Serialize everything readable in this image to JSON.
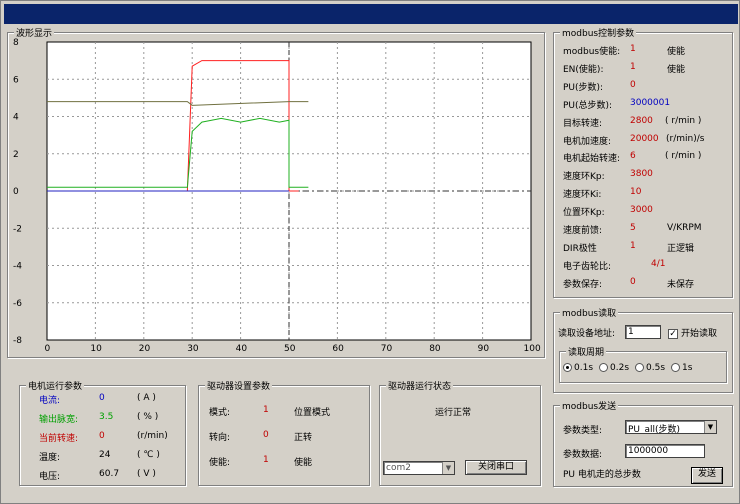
{
  "waveform": {
    "title": "波形显示",
    "y_ticks": [
      "8",
      "6",
      "4",
      "2",
      "0",
      "-2",
      "-4",
      "-6",
      "-8"
    ],
    "x_ticks": [
      "0",
      "10",
      "20",
      "30",
      "40",
      "50",
      "60",
      "70",
      "80",
      "90",
      "100"
    ],
    "colors": {
      "red": "#ff2020",
      "green": "#20b020",
      "olive": "#707040",
      "blue": "#2020c0"
    }
  },
  "chart_data": {
    "type": "line",
    "title": "",
    "xlabel": "",
    "ylabel": "",
    "xlim": [
      0,
      100
    ],
    "ylim": [
      -8,
      8
    ],
    "grid": true,
    "series": [
      {
        "color": "#ff2020",
        "x": [
          0,
          29,
          30,
          32,
          50,
          50,
          52
        ],
        "y": [
          0,
          0,
          6.7,
          7,
          7,
          0,
          0
        ]
      },
      {
        "color": "#20b020",
        "x": [
          0,
          29,
          30,
          32,
          36,
          40,
          44,
          48,
          50,
          50,
          54
        ],
        "y": [
          0.2,
          0.2,
          3.2,
          3.7,
          3.9,
          3.7,
          3.9,
          3.7,
          3.8,
          0.2,
          0.2
        ]
      },
      {
        "color": "#707040",
        "x": [
          0,
          29,
          30,
          50,
          54
        ],
        "y": [
          4.8,
          4.8,
          4.6,
          4.8,
          4.8
        ]
      },
      {
        "color": "#2020c0",
        "x": [
          0,
          50
        ],
        "y": [
          0,
          0
        ]
      }
    ]
  },
  "motor_params": {
    "title": "电机运行参数",
    "rows": [
      {
        "label": "电流:",
        "value": "0",
        "unit": "( A )",
        "color": "#0000c0"
      },
      {
        "label": "输出脉宽:",
        "value": "3.5",
        "unit": "( % )",
        "color": "#00a000"
      },
      {
        "label": "当前转速:",
        "value": "0",
        "unit": "(r/min)",
        "color": "#c00000"
      },
      {
        "label": "温度:",
        "value": "24",
        "unit": "( ℃ )",
        "color": "#000000"
      },
      {
        "label": "电压:",
        "value": "60.7",
        "unit": "( V )",
        "color": "#000000"
      }
    ]
  },
  "driver_settings": {
    "title": "驱动器设置参数",
    "rows": [
      {
        "label": "模式:",
        "value": "1",
        "desc": "位置模式"
      },
      {
        "label": "转向:",
        "value": "0",
        "desc": "正转"
      },
      {
        "label": "使能:",
        "value": "1",
        "desc": "使能"
      }
    ]
  },
  "driver_status": {
    "title": "驱动器运行状态",
    "status": "运行正常",
    "port": "com2",
    "close_port_label": "关闭串口"
  },
  "modbus_control": {
    "title": "modbus控制参数",
    "rows": [
      {
        "label": "modbus使能:",
        "value": "1",
        "desc": "使能"
      },
      {
        "label": "EN(使能):",
        "value": "1",
        "desc": "使能"
      },
      {
        "label": "PU(步数):",
        "value": "0",
        "desc": ""
      },
      {
        "label": "PU(总步数):",
        "value": "3000001",
        "desc": "",
        "blue": true
      },
      {
        "label": "目标转速:",
        "value": "2800",
        "desc": "( r/min )"
      },
      {
        "label": "电机加速度:",
        "value": "20000",
        "desc": "(r/min)/s"
      },
      {
        "label": "电机起始转速:",
        "value": "6",
        "desc": "( r/min )"
      },
      {
        "label": "速度环Kp:",
        "value": "3800",
        "desc": ""
      },
      {
        "label": "速度环Ki:",
        "value": "10",
        "desc": ""
      },
      {
        "label": "位置环Kp:",
        "value": "3000",
        "desc": ""
      },
      {
        "label": "速度前馈:",
        "value": "5",
        "desc": "V/KRPM"
      },
      {
        "label": "DIR极性",
        "value": "1",
        "desc": "正逻辑"
      },
      {
        "label": "电子齿轮比:",
        "value": "4/1",
        "desc": ""
      },
      {
        "label": "参数保存:",
        "value": "0",
        "desc": "未保存"
      }
    ]
  },
  "modbus_read": {
    "title": "modbus读取",
    "addr_label": "读取设备地址:",
    "addr_value": "1",
    "start_read_label": "开始读取",
    "period_title": "读取周期",
    "periods": [
      "0.1s",
      "0.2s",
      "0.5s",
      "1s"
    ],
    "selected_period": "0.1s"
  },
  "modbus_send": {
    "title": "modbus发送",
    "param_type_label": "参数类型:",
    "param_type_value": "PU_all(步数)",
    "param_data_label": "参数数据:",
    "param_data_value": "1000000",
    "hint": "PU 电机走的总步数",
    "send_label": "发送"
  }
}
